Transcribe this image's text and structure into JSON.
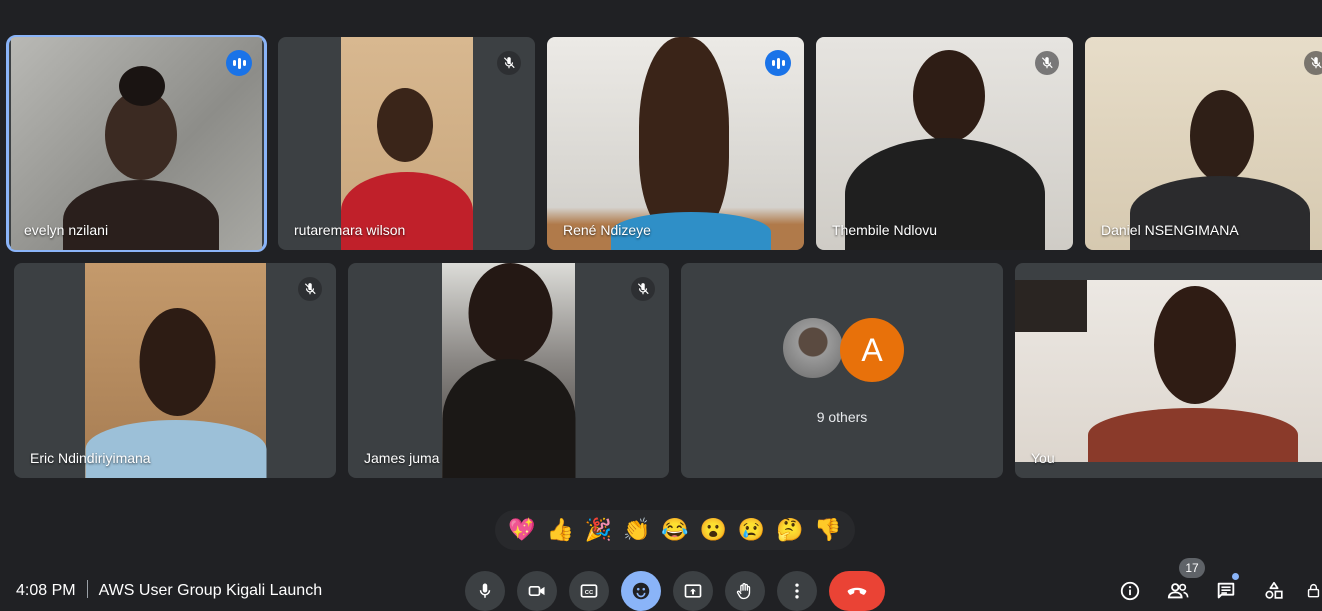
{
  "participants": [
    {
      "name": "evelyn nzilani",
      "status": "speaking"
    },
    {
      "name": "rutaremara wilson",
      "status": "muted"
    },
    {
      "name": "René Ndizeye",
      "status": "speaking"
    },
    {
      "name": "Thembile Ndlovu",
      "status": "muted"
    },
    {
      "name": "Daniel NSENGIMANA",
      "status": "muted"
    },
    {
      "name": "Eric Ndindiriyimana",
      "status": "muted"
    },
    {
      "name": "James juma",
      "status": "muted"
    },
    {
      "name": "You",
      "status": "unmuted"
    }
  ],
  "others": {
    "letter": "A",
    "label": "9 others",
    "avatar_color": "#e8710a"
  },
  "reactions": [
    {
      "emoji": "💖",
      "name": "sparkling-heart"
    },
    {
      "emoji": "👍",
      "name": "thumbs-up"
    },
    {
      "emoji": "🎉",
      "name": "party-popper"
    },
    {
      "emoji": "👏",
      "name": "clapping-hands"
    },
    {
      "emoji": "😂",
      "name": "tears-of-joy"
    },
    {
      "emoji": "😮",
      "name": "surprised"
    },
    {
      "emoji": "😢",
      "name": "crying"
    },
    {
      "emoji": "🤔",
      "name": "thinking"
    },
    {
      "emoji": "👎",
      "name": "thumbs-down"
    }
  ],
  "meeting": {
    "time": "4:08 PM",
    "title": "AWS User Group Kigali Launch"
  },
  "controls": [
    "mic-icon",
    "camera-icon",
    "captions-icon",
    "emoji-icon",
    "present-icon",
    "raise-hand-icon",
    "more-options-icon",
    "end-call-icon"
  ],
  "people_count": "17",
  "colors": {
    "background": "#202124",
    "tile": "#3c4043",
    "accent": "#8ab4f8",
    "end_call": "#ea4335",
    "speaking": "#1a73e8"
  }
}
